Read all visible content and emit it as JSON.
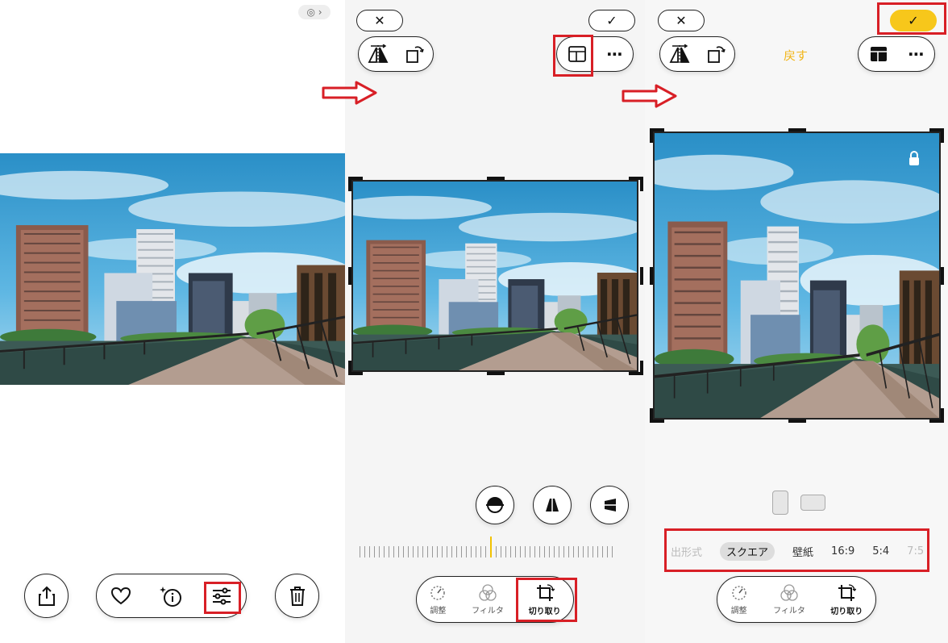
{
  "panel1": {
    "badge_icon": "live-photo-badge-icon",
    "toolbar": {
      "share_icon": "share-icon",
      "favorite_icon": "heart-icon",
      "info_icon": "sparkle-info-icon",
      "edit_icon": "adjust-sliders-icon",
      "delete_icon": "trash-icon"
    }
  },
  "panel2": {
    "cancel": "✕",
    "done": "✓",
    "dial_marker_color": "#f2c200",
    "tabs": [
      {
        "label": "調整",
        "icon": "adjust-dial-icon"
      },
      {
        "label": "フィルタ",
        "icon": "filter-circles-icon"
      },
      {
        "label": "切り取り",
        "icon": "crop-rotate-icon"
      }
    ]
  },
  "panel3": {
    "cancel": "✕",
    "done": "✓",
    "done_color": "#f7c71b",
    "back": "戻す",
    "back_color": "#f2b61b",
    "ratios": [
      "出形式",
      "スクエア",
      "壁紙",
      "16:9",
      "5:4",
      "7:5"
    ],
    "selected_ratio": "スクエア",
    "tabs": [
      {
        "label": "調整",
        "icon": "adjust-dial-icon"
      },
      {
        "label": "フィルタ",
        "icon": "filter-circles-icon"
      },
      {
        "label": "切り取り",
        "icon": "crop-rotate-icon"
      }
    ]
  },
  "colors": {
    "highlight": "#d81f26",
    "accent_yellow": "#f7c71b"
  }
}
